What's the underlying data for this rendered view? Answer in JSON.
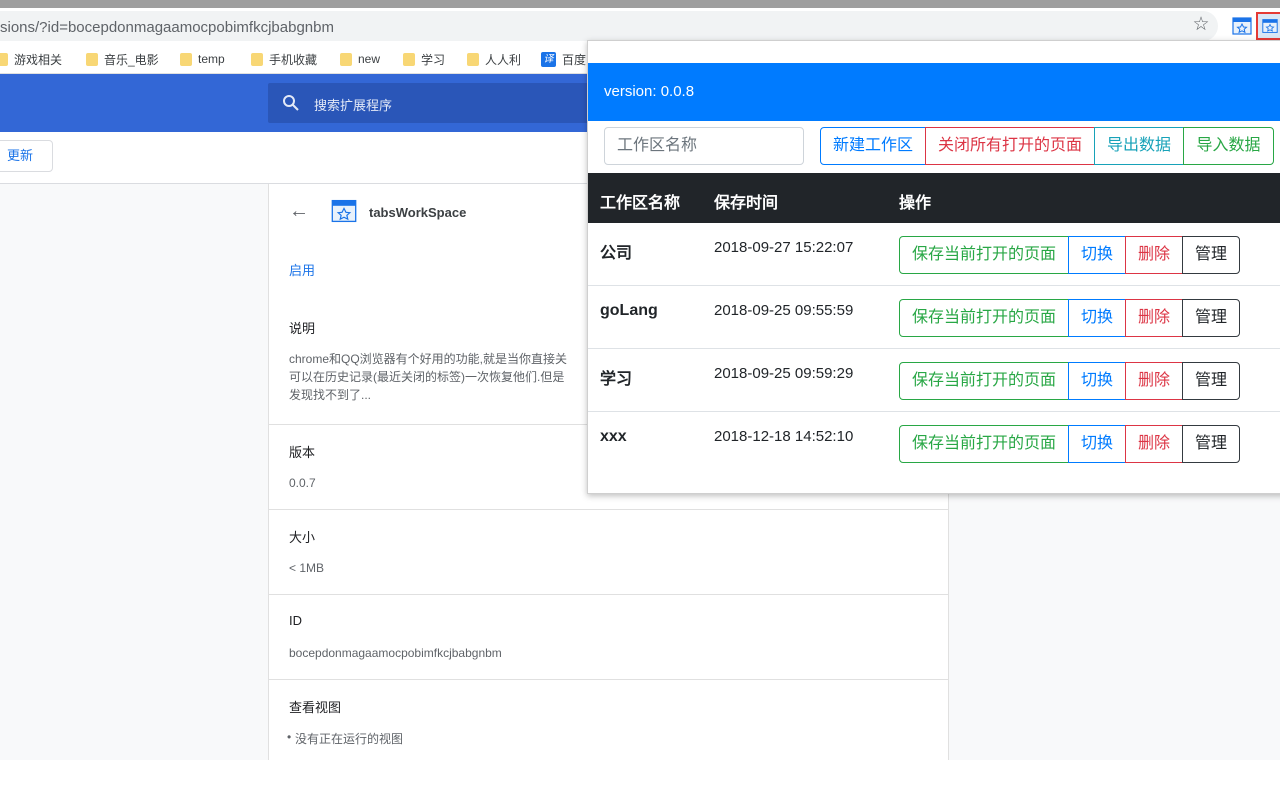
{
  "browser": {
    "url": "sions/?id=bocepdonmagaamocpobimfkcjbabgnbm",
    "bookmarks": [
      "游戏相关",
      "音乐_电影",
      "temp",
      "手机收藏",
      "new",
      "学习",
      "人人利",
      "百度"
    ]
  },
  "extensions_page": {
    "search_placeholder": "搜索扩展程序",
    "update_button": "更新",
    "extension_name": "tabsWorkSpace",
    "enable_label": "启用",
    "description_label": "说明",
    "description_text": "chrome和QQ浏览器有个好用的功能,就是当你直接关\n可以在历史记录(最近关闭的标签)一次恢复他们.但是\n发现找不到了...",
    "version_label": "版本",
    "version_value": "0.0.7",
    "size_label": "大小",
    "size_value": "< 1MB",
    "id_label": "ID",
    "id_value": "bocepdonmagaamocpobimfkcjbabgnbm",
    "views_label": "查看视图",
    "views_item": "没有正在运行的视图"
  },
  "popup": {
    "version": "version: 0.0.8",
    "input_placeholder": "工作区名称",
    "buttons": {
      "new": "新建工作区",
      "close_all": "关闭所有打开的页面",
      "export": "导出数据",
      "import": "导入数据"
    },
    "table": {
      "headers": [
        "工作区名称",
        "保存时间",
        "操作"
      ],
      "rows": [
        {
          "name": "公司",
          "time": "2018-09-27 15:22:07"
        },
        {
          "name": "goLang",
          "time": "2018-09-25 09:55:59"
        },
        {
          "name": "学习",
          "time": "2018-09-25 09:59:29"
        },
        {
          "name": "xxx",
          "time": "2018-12-18 14:52:10"
        }
      ],
      "actions": {
        "save": "保存当前打开的页面",
        "switch": "切换",
        "delete": "删除",
        "manage": "管理"
      }
    }
  },
  "colors": {
    "primary": "#007bff",
    "danger": "#dc3545",
    "info": "#17a2b8",
    "success": "#28a745",
    "dark": "#212529",
    "chrome_blue": "#3367d6"
  }
}
